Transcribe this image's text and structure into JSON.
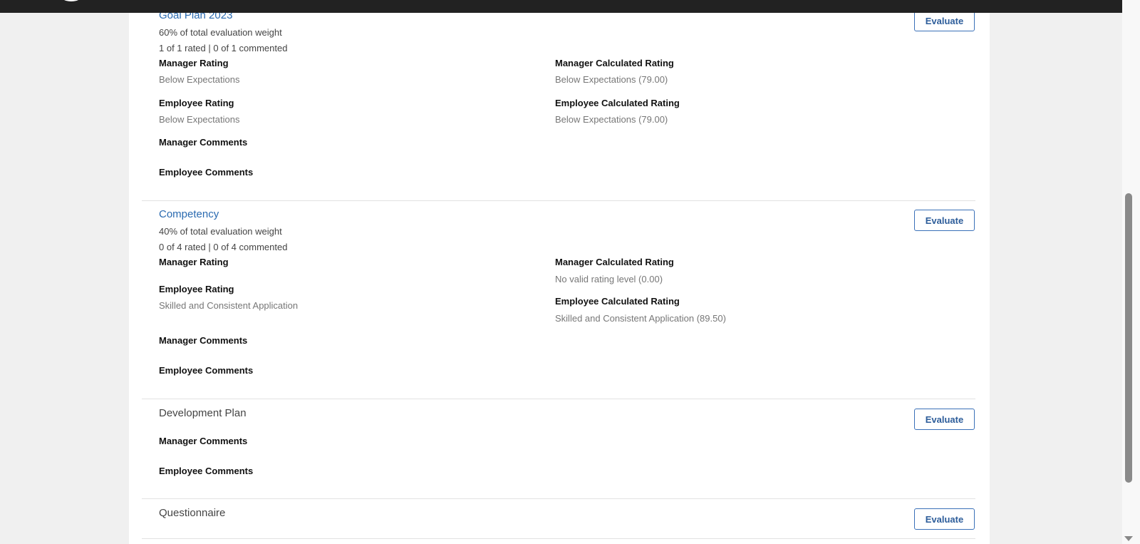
{
  "sections": [
    {
      "title": "Goal Plan 2023",
      "weight": "60% of total evaluation weight",
      "progress": "1 of 1 rated | 0 of 1 commented",
      "manager_rating_label": "Manager Rating",
      "manager_rating": "Below Expectations",
      "employee_rating_label": "Employee Rating",
      "employee_rating": "Below Expectations",
      "manager_calc_label": "Manager Calculated Rating",
      "manager_calc": "Below Expectations (79.00)",
      "employee_calc_label": "Employee Calculated Rating",
      "employee_calc": "Below Expectations (79.00)",
      "manager_comments_label": "Manager Comments",
      "employee_comments_label": "Employee Comments",
      "button": "Evaluate"
    },
    {
      "title": "Competency",
      "weight": "40% of total evaluation weight",
      "progress": "0 of 4 rated | 0 of 4 commented",
      "manager_rating_label": "Manager Rating",
      "employee_rating_label": "Employee Rating",
      "employee_rating": "Skilled and Consistent Application",
      "manager_calc_label": "Manager Calculated Rating",
      "manager_calc": "No valid rating level (0.00)",
      "employee_calc_label": "Employee Calculated Rating",
      "employee_calc": "Skilled and Consistent Application (89.50)",
      "manager_comments_label": "Manager Comments",
      "employee_comments_label": "Employee Comments",
      "button": "Evaluate"
    },
    {
      "title": "Development Plan",
      "manager_comments_label": "Manager Comments",
      "employee_comments_label": "Employee Comments",
      "button": "Evaluate"
    },
    {
      "title": "Questionnaire",
      "button": "Evaluate"
    }
  ]
}
